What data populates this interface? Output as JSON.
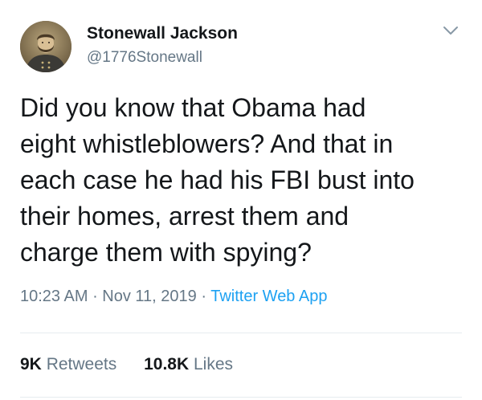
{
  "author": {
    "display_name": "Stonewall Jackson",
    "handle": "@1776Stonewall",
    "avatar_icon": "portrait-avatar"
  },
  "tweet": {
    "text": "Did you know that Obama had\neight whistleblowers? And that in\neach case he had his FBI bust into\ntheir homes, arrest them and\ncharge them with spying?"
  },
  "meta": {
    "time": "10:23 AM",
    "separator": " · ",
    "date": "Nov 11, 2019",
    "source": "Twitter Web App"
  },
  "stats": {
    "retweets_count": "9K",
    "retweets_label": "Retweets",
    "likes_count": "10.8K",
    "likes_label": "Likes"
  },
  "colors": {
    "text": "#14171a",
    "secondary": "#657786",
    "link": "#1da1f2",
    "divider": "#e6ecf0"
  },
  "icons": {
    "caret": "chevron-down-icon"
  }
}
